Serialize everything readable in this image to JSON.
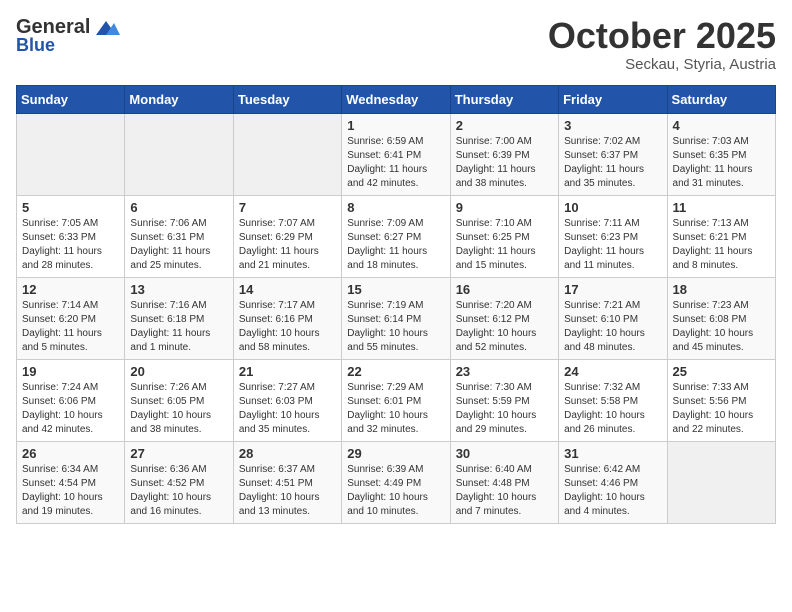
{
  "header": {
    "logo": {
      "general": "General",
      "blue": "Blue"
    },
    "title": "October 2025",
    "subtitle": "Seckau, Styria, Austria"
  },
  "weekdays": [
    "Sunday",
    "Monday",
    "Tuesday",
    "Wednesday",
    "Thursday",
    "Friday",
    "Saturday"
  ],
  "weeks": [
    [
      {
        "day": "",
        "info": ""
      },
      {
        "day": "",
        "info": ""
      },
      {
        "day": "",
        "info": ""
      },
      {
        "day": "1",
        "info": "Sunrise: 6:59 AM\nSunset: 6:41 PM\nDaylight: 11 hours\nand 42 minutes."
      },
      {
        "day": "2",
        "info": "Sunrise: 7:00 AM\nSunset: 6:39 PM\nDaylight: 11 hours\nand 38 minutes."
      },
      {
        "day": "3",
        "info": "Sunrise: 7:02 AM\nSunset: 6:37 PM\nDaylight: 11 hours\nand 35 minutes."
      },
      {
        "day": "4",
        "info": "Sunrise: 7:03 AM\nSunset: 6:35 PM\nDaylight: 11 hours\nand 31 minutes."
      }
    ],
    [
      {
        "day": "5",
        "info": "Sunrise: 7:05 AM\nSunset: 6:33 PM\nDaylight: 11 hours\nand 28 minutes."
      },
      {
        "day": "6",
        "info": "Sunrise: 7:06 AM\nSunset: 6:31 PM\nDaylight: 11 hours\nand 25 minutes."
      },
      {
        "day": "7",
        "info": "Sunrise: 7:07 AM\nSunset: 6:29 PM\nDaylight: 11 hours\nand 21 minutes."
      },
      {
        "day": "8",
        "info": "Sunrise: 7:09 AM\nSunset: 6:27 PM\nDaylight: 11 hours\nand 18 minutes."
      },
      {
        "day": "9",
        "info": "Sunrise: 7:10 AM\nSunset: 6:25 PM\nDaylight: 11 hours\nand 15 minutes."
      },
      {
        "day": "10",
        "info": "Sunrise: 7:11 AM\nSunset: 6:23 PM\nDaylight: 11 hours\nand 11 minutes."
      },
      {
        "day": "11",
        "info": "Sunrise: 7:13 AM\nSunset: 6:21 PM\nDaylight: 11 hours\nand 8 minutes."
      }
    ],
    [
      {
        "day": "12",
        "info": "Sunrise: 7:14 AM\nSunset: 6:20 PM\nDaylight: 11 hours\nand 5 minutes."
      },
      {
        "day": "13",
        "info": "Sunrise: 7:16 AM\nSunset: 6:18 PM\nDaylight: 11 hours\nand 1 minute."
      },
      {
        "day": "14",
        "info": "Sunrise: 7:17 AM\nSunset: 6:16 PM\nDaylight: 10 hours\nand 58 minutes."
      },
      {
        "day": "15",
        "info": "Sunrise: 7:19 AM\nSunset: 6:14 PM\nDaylight: 10 hours\nand 55 minutes."
      },
      {
        "day": "16",
        "info": "Sunrise: 7:20 AM\nSunset: 6:12 PM\nDaylight: 10 hours\nand 52 minutes."
      },
      {
        "day": "17",
        "info": "Sunrise: 7:21 AM\nSunset: 6:10 PM\nDaylight: 10 hours\nand 48 minutes."
      },
      {
        "day": "18",
        "info": "Sunrise: 7:23 AM\nSunset: 6:08 PM\nDaylight: 10 hours\nand 45 minutes."
      }
    ],
    [
      {
        "day": "19",
        "info": "Sunrise: 7:24 AM\nSunset: 6:06 PM\nDaylight: 10 hours\nand 42 minutes."
      },
      {
        "day": "20",
        "info": "Sunrise: 7:26 AM\nSunset: 6:05 PM\nDaylight: 10 hours\nand 38 minutes."
      },
      {
        "day": "21",
        "info": "Sunrise: 7:27 AM\nSunset: 6:03 PM\nDaylight: 10 hours\nand 35 minutes."
      },
      {
        "day": "22",
        "info": "Sunrise: 7:29 AM\nSunset: 6:01 PM\nDaylight: 10 hours\nand 32 minutes."
      },
      {
        "day": "23",
        "info": "Sunrise: 7:30 AM\nSunset: 5:59 PM\nDaylight: 10 hours\nand 29 minutes."
      },
      {
        "day": "24",
        "info": "Sunrise: 7:32 AM\nSunset: 5:58 PM\nDaylight: 10 hours\nand 26 minutes."
      },
      {
        "day": "25",
        "info": "Sunrise: 7:33 AM\nSunset: 5:56 PM\nDaylight: 10 hours\nand 22 minutes."
      }
    ],
    [
      {
        "day": "26",
        "info": "Sunrise: 6:34 AM\nSunset: 4:54 PM\nDaylight: 10 hours\nand 19 minutes."
      },
      {
        "day": "27",
        "info": "Sunrise: 6:36 AM\nSunset: 4:52 PM\nDaylight: 10 hours\nand 16 minutes."
      },
      {
        "day": "28",
        "info": "Sunrise: 6:37 AM\nSunset: 4:51 PM\nDaylight: 10 hours\nand 13 minutes."
      },
      {
        "day": "29",
        "info": "Sunrise: 6:39 AM\nSunset: 4:49 PM\nDaylight: 10 hours\nand 10 minutes."
      },
      {
        "day": "30",
        "info": "Sunrise: 6:40 AM\nSunset: 4:48 PM\nDaylight: 10 hours\nand 7 minutes."
      },
      {
        "day": "31",
        "info": "Sunrise: 6:42 AM\nSunset: 4:46 PM\nDaylight: 10 hours\nand 4 minutes."
      },
      {
        "day": "",
        "info": ""
      }
    ]
  ]
}
